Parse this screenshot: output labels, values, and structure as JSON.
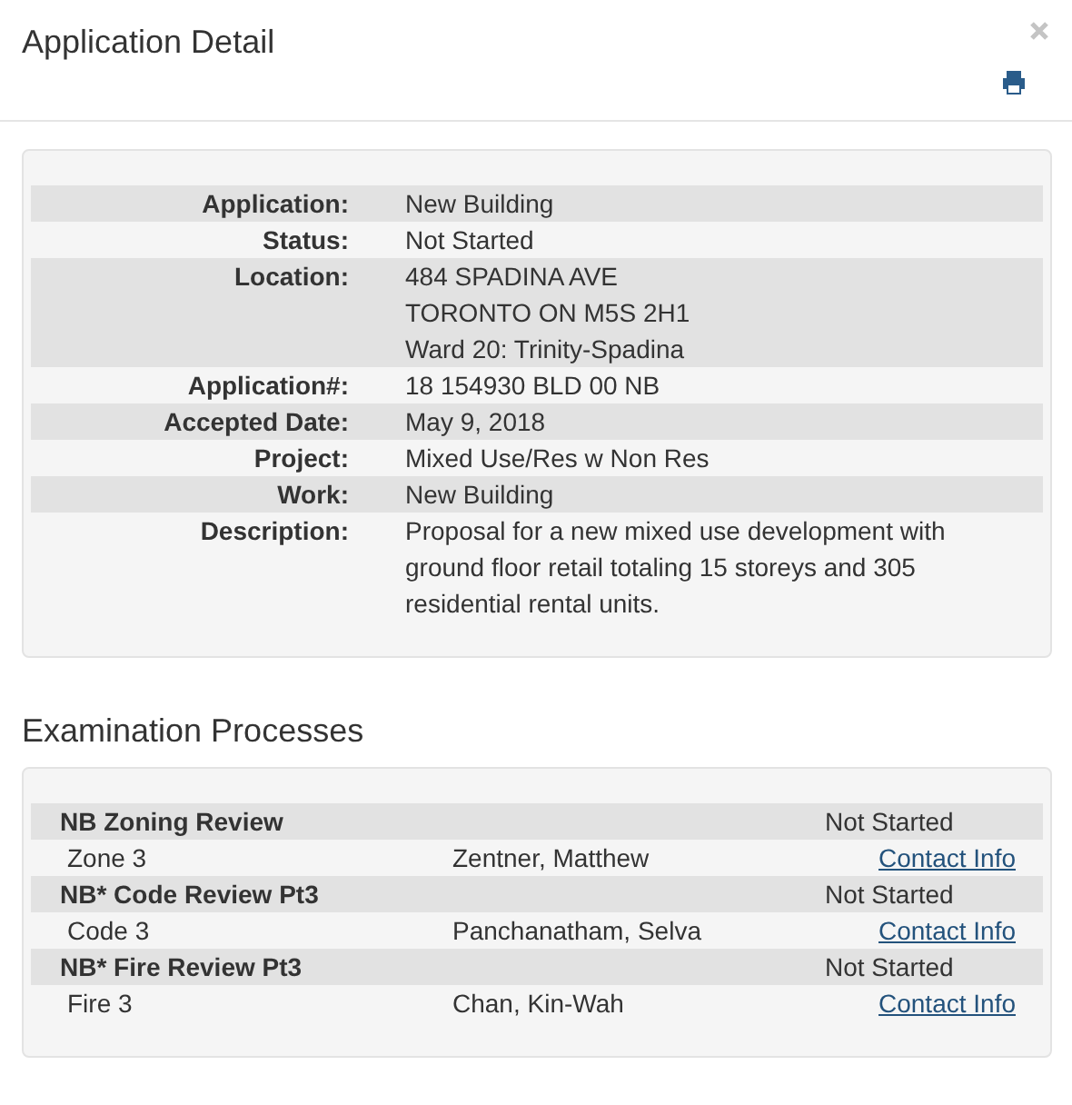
{
  "window": {
    "title": "Application Detail"
  },
  "details": [
    {
      "label": "Application:",
      "lines": [
        "New Building"
      ]
    },
    {
      "label": "Status:",
      "lines": [
        "Not Started"
      ]
    },
    {
      "label": "Location:",
      "lines": [
        "484 SPADINA AVE",
        "TORONTO ON M5S 2H1",
        "Ward 20: Trinity-Spadina"
      ]
    },
    {
      "label": "Application#:",
      "lines": [
        "18 154930 BLD 00 NB"
      ]
    },
    {
      "label": "Accepted Date:",
      "lines": [
        "May 9, 2018"
      ]
    },
    {
      "label": "Project:",
      "lines": [
        "Mixed Use/Res w Non Res"
      ]
    },
    {
      "label": "Work:",
      "lines": [
        "New Building"
      ]
    },
    {
      "label": "Description:",
      "lines": [
        "Proposal for a new mixed use development with ground floor retail totaling 15 storeys and 305 residential rental units."
      ]
    }
  ],
  "processes_title": "Examination Processes",
  "processes": [
    {
      "name": "NB Zoning Review",
      "status": "Not Started",
      "area": "Zone 3",
      "examiner": "Zentner, Matthew",
      "link": "Contact Info"
    },
    {
      "name": "NB* Code Review Pt3",
      "status": "Not Started",
      "area": "Code 3",
      "examiner": "Panchanatham, Selva",
      "link": "Contact Info"
    },
    {
      "name": "NB* Fire Review Pt3",
      "status": "Not Started",
      "area": "Fire 3",
      "examiner": "Chan, Kin-Wah",
      "link": "Contact Info"
    }
  ]
}
